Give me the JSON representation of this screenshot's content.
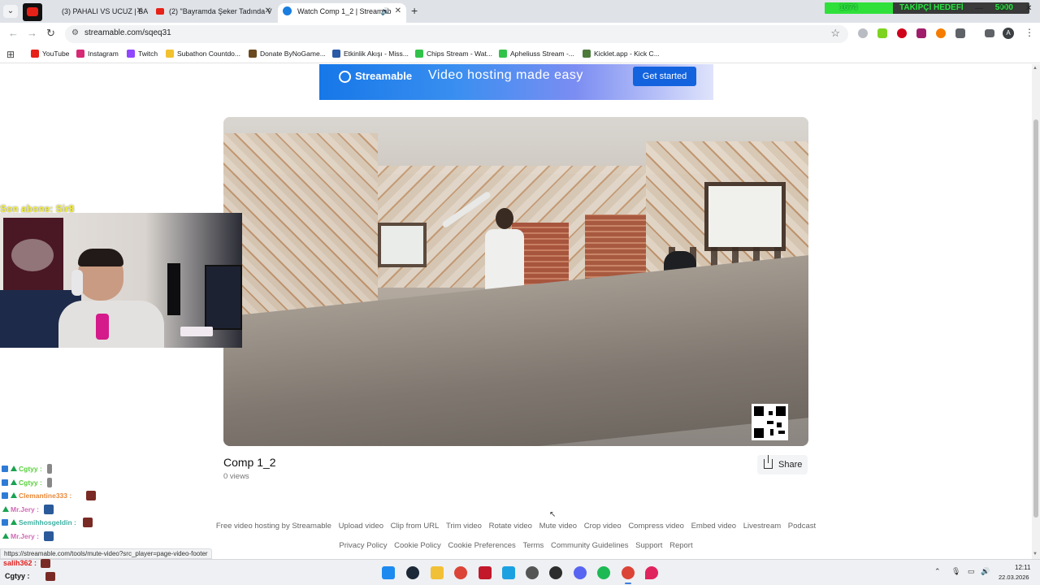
{
  "browser": {
    "tabs": [
      {
        "title": "PAHALI VS UCUZ | BAYRAM",
        "prefix": "(3)",
        "close": "✕"
      },
      {
        "title": "(2) \"Bayramda Şeker Tadında V",
        "close": "✕"
      },
      {
        "title": "Watch Comp 1_2 | Streamab",
        "close": "✕",
        "audio": "🔊"
      }
    ],
    "new_tab": "+",
    "follower_goal": {
      "current": "1674",
      "label": "TAKİPÇİ HEDEFİ",
      "target": "5000",
      "fraction": 0.335
    },
    "window_controls": {
      "minimize": "—",
      "maximize": "☐",
      "close": "✕"
    },
    "address": "streamable.com/sqeq31",
    "nav": {
      "back": "←",
      "forward": "→",
      "reload": "↻"
    },
    "profile_initial": "A",
    "bookmarks": [
      {
        "label": "YouTube",
        "color": "#e62117"
      },
      {
        "label": "Instagram",
        "color": "#d62976"
      },
      {
        "label": "Twitch",
        "color": "#9146ff"
      },
      {
        "label": "Subathon Countdo...",
        "color": "#f2c12e"
      },
      {
        "label": "Donate ByNoGame...",
        "color": "#6b4a1f"
      },
      {
        "label": "Etkinlik Akışı - Miss...",
        "color": "#2b5aa6"
      },
      {
        "label": "Chips Stream - Wat...",
        "color": "#31c24a"
      },
      {
        "label": "Apheliuss Stream -...",
        "color": "#31c24a"
      },
      {
        "label": "Kicklet.app - Kick C...",
        "color": "#4d7a3a"
      }
    ]
  },
  "banner": {
    "brand": "Streamable",
    "tagline": "Video hosting made easy",
    "cta": "Get started"
  },
  "video": {
    "title": "Comp 1_2",
    "views": "0 views",
    "share_label": "Share"
  },
  "footer": {
    "row1": [
      "Free video hosting by Streamable",
      "Upload video",
      "Clip from URL",
      "Trim video",
      "Rotate video",
      "Mute video",
      "Crop video",
      "Compress video",
      "Embed video",
      "Livestream",
      "Podcast"
    ],
    "row2": [
      "Privacy Policy",
      "Cookie Policy",
      "Cookie Preferences",
      "Terms",
      "Community Guidelines",
      "Support",
      "Report"
    ]
  },
  "status_url": "https://streamable.com/tools/mute-video?src_player=page-video-footer",
  "overlay": {
    "last_sub": "Son abone: Sir8",
    "chat": [
      {
        "name": "Cgtyy",
        "color": "#57d13a",
        "suffix": ":"
      },
      {
        "name": "Cgtyy",
        "color": "#57d13a",
        "suffix": ":"
      },
      {
        "name": "Clemantine333",
        "color": "#e8893a",
        "suffix": ":"
      },
      {
        "name": "Mr.Jery",
        "color": "#d06bb4",
        "suffix": ":"
      },
      {
        "name": "Semihhosgeldin",
        "color": "#3fb0a2",
        "suffix": ":"
      },
      {
        "name": "Mr.Jery",
        "color": "#d06bb4",
        "suffix": ":"
      }
    ],
    "bottom_chat": [
      {
        "name": "salih362",
        "color": "#e02020",
        "suffix": ":"
      },
      {
        "name": "Cgtyy",
        "color": "#111111",
        "suffix": ":"
      }
    ]
  },
  "taskbar": {
    "time": "12:11",
    "date": "22.03.2026",
    "apps": [
      {
        "name": "windows-start-icon",
        "color": "#1d8af0"
      },
      {
        "name": "steam-icon",
        "color": "#1b2838"
      },
      {
        "name": "file-explorer-icon",
        "color": "#f2c037"
      },
      {
        "name": "chrome-icon",
        "color": "#db4437"
      },
      {
        "name": "speedtest-icon",
        "color": "#c2182a"
      },
      {
        "name": "snipping-icon",
        "color": "#1ba1e2"
      },
      {
        "name": "obs-alt-icon",
        "color": "#555555"
      },
      {
        "name": "obs-icon",
        "color": "#2d2d2d"
      },
      {
        "name": "discord-icon",
        "color": "#5865f2"
      },
      {
        "name": "spotify-icon",
        "color": "#1db954"
      },
      {
        "name": "chrome-active-icon",
        "color": "#db4437"
      },
      {
        "name": "maps-pin-icon",
        "color": "#e0245e"
      }
    ]
  }
}
